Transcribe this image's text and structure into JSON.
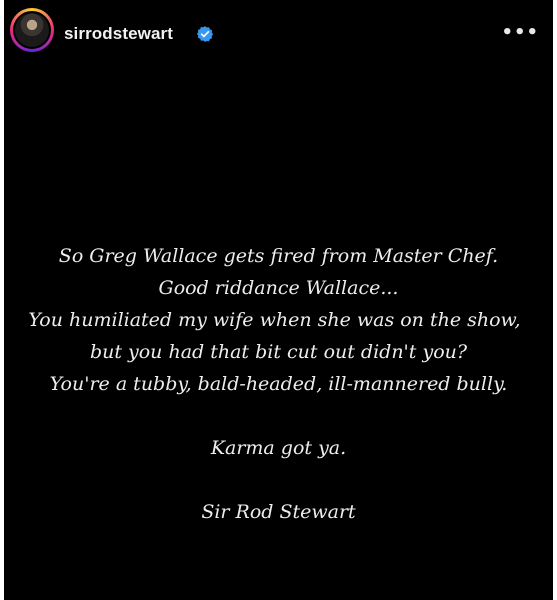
{
  "header": {
    "username": "sirrodstewart",
    "avatar_icon": "profile-photo",
    "verified_icon": "verified-badge-icon",
    "more_label": "•••"
  },
  "colors": {
    "background": "#000000",
    "text": "#ededed",
    "verified_blue": "#3897f0"
  },
  "story": {
    "line1": "So Greg Wallace gets fired from Master Chef.",
    "line2": "Good riddance Wallace...",
    "line3": "You humiliated my wife when she was on the show,",
    "line4": "but you had that bit cut out didn't you?",
    "line5": "You're a tubby, bald-headed, ill-mannered bully.",
    "line6": "Karma got ya.",
    "signature": "Sir Rod Stewart"
  }
}
